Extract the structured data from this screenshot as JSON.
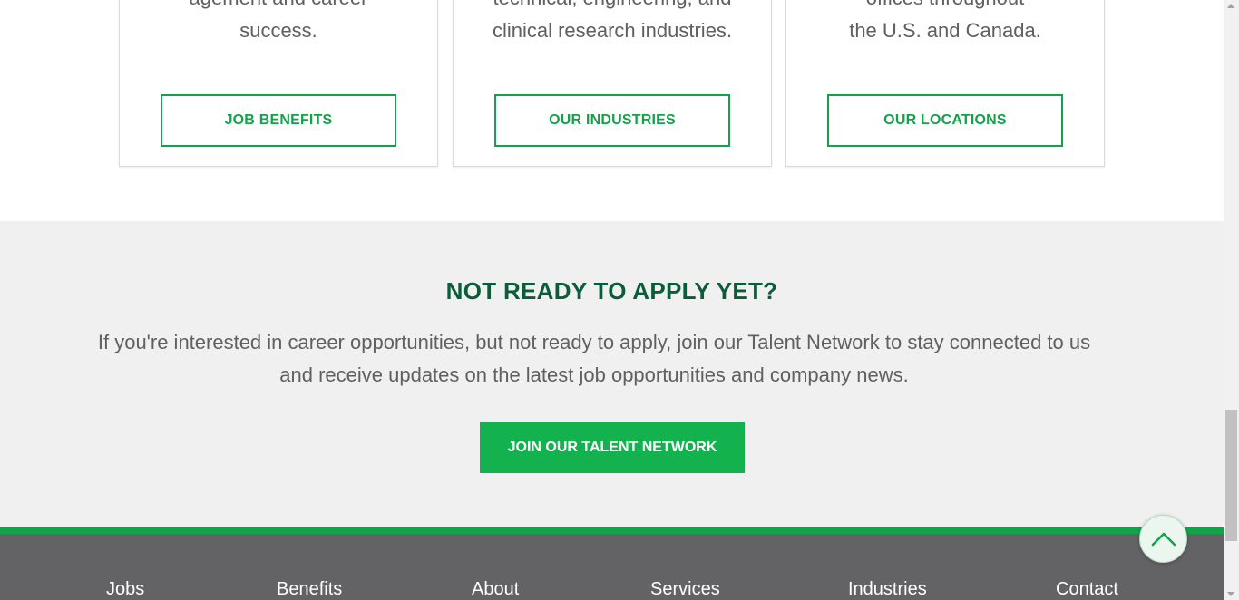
{
  "cards": [
    {
      "desc_line1": "agement and career",
      "desc_line2": "success.",
      "button": "JOB BENEFITS"
    },
    {
      "desc_line1": "technical, engineering, and",
      "desc_line2": "clinical research industries.",
      "button": "OUR INDUSTRIES"
    },
    {
      "desc_line1": "offices throughout",
      "desc_line2": "the U.S. and Canada.",
      "button": "OUR LOCATIONS"
    }
  ],
  "cta": {
    "heading": "NOT READY TO APPLY YET?",
    "body": "If you're interested in career opportunities, but not ready to apply, join our Talent Network to stay connected to us and receive updates on the latest job opportunities and company news.",
    "button": "JOIN OUR TALENT NETWORK"
  },
  "footer": {
    "links": [
      "Jobs",
      "Benefits",
      "About",
      "Services",
      "Industries",
      "Contact"
    ]
  },
  "icons": {
    "back_to_top": "chevron-up-icon"
  },
  "colors": {
    "brand_green": "#13a24a",
    "heading_green": "#0b5c3b",
    "footer_gray": "#636365",
    "section_bg": "#eff0ef"
  }
}
